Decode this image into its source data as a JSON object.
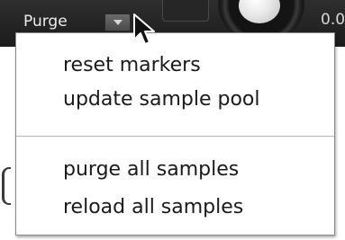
{
  "panel": {
    "purge_label": "Purge",
    "knob_value": "0.0"
  },
  "menu": {
    "items": [
      {
        "label": "reset markers"
      },
      {
        "label": "update sample pool"
      },
      {
        "label": "purge all samples"
      },
      {
        "label": "reload all samples"
      }
    ]
  },
  "icons": {
    "dropdown": "chevron-down-icon",
    "cursor": "mouse-cursor-icon"
  },
  "colors": {
    "panel_background": "#1c1c1c",
    "menu_background": "#ffffff",
    "menu_text": "#1a1a1a",
    "separator": "#b4b4b4"
  }
}
